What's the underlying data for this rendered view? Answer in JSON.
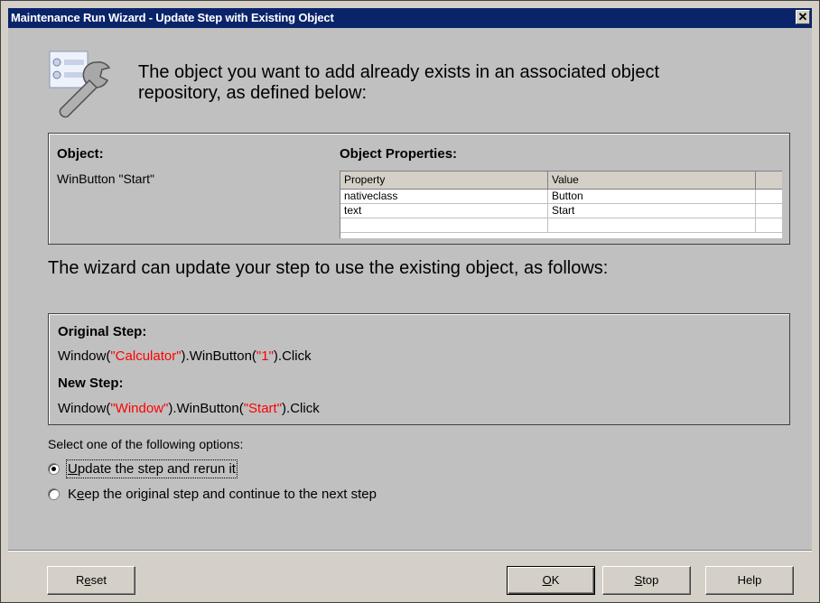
{
  "window": {
    "title": "Maintenance Run Wizard - Update Step with Existing Object",
    "close_symbol": "✕"
  },
  "intro": {
    "icon": "object-repository-wrench-icon",
    "text": "The object you want to add already exists in an associated object repository, as defined below:"
  },
  "object_panel": {
    "object_label": "Object:",
    "object_value": "WinButton \"Start\"",
    "properties_label": "Object Properties:",
    "columns": [
      "Property",
      "Value"
    ],
    "rows": [
      {
        "property": "nativeclass",
        "value": "Button"
      },
      {
        "property": "text",
        "value": "Start"
      }
    ]
  },
  "wizard_text": "The wizard can update your step to use the existing object, as follows:",
  "steps": {
    "original_label": "Original Step:",
    "original": {
      "p1": "Window(",
      "arg1": "\"Calculator\"",
      "p2": ").WinButton(",
      "arg2": "\"1\"",
      "p3": ").Click"
    },
    "new_label": "New Step:",
    "new": {
      "p1": "Window(",
      "arg1": "\"Window\"",
      "p2": ").WinButton(",
      "arg2": "\"Start\"",
      "p3": ").Click"
    },
    "argument_color": "#ff0000"
  },
  "options": {
    "label": "Select one of the following options:",
    "items": [
      {
        "mnemonic": "U",
        "rest": "pdate the step and rerun it",
        "selected": true
      },
      {
        "prefix": "K",
        "mnemonic": "e",
        "rest": "ep the original step and continue to the next step",
        "selected": false
      }
    ]
  },
  "buttons": {
    "reset": {
      "pre": "R",
      "mnemonic": "e",
      "rest": "set"
    },
    "ok": {
      "mnemonic": "O",
      "rest": "K"
    },
    "stop": {
      "mnemonic": "S",
      "rest": "top"
    },
    "help": "Help"
  },
  "colors": {
    "titlebar": "#0a246a",
    "dialog_face": "#c0c0c0"
  }
}
